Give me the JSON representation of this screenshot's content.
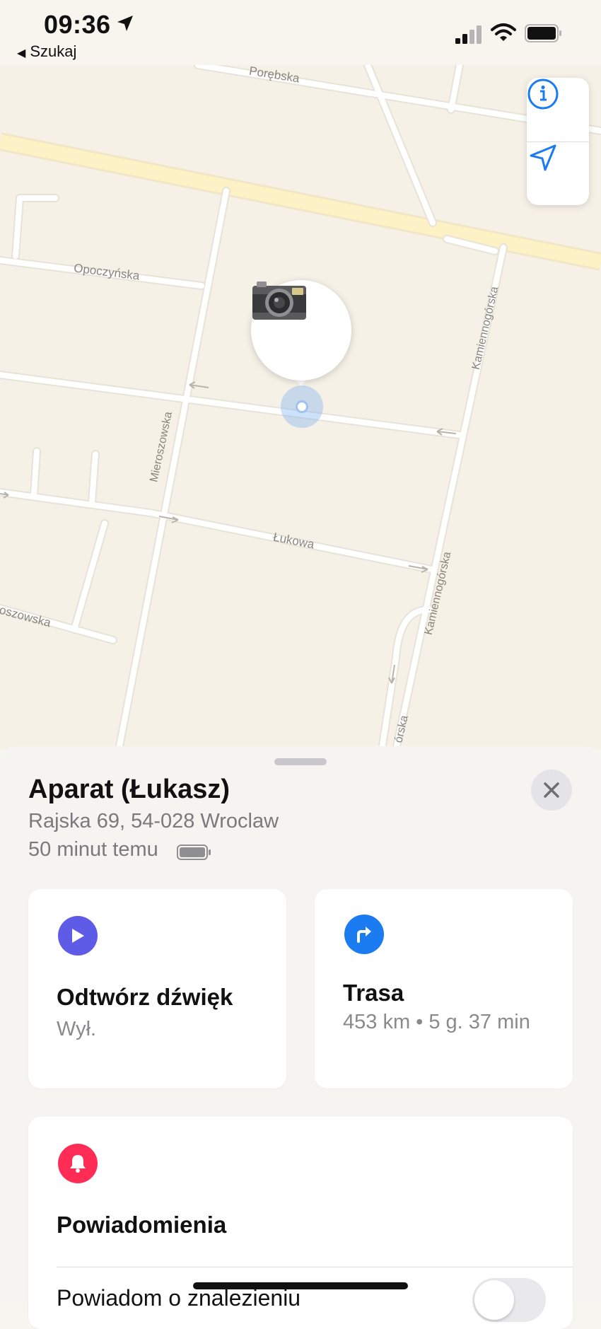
{
  "status_bar": {
    "time": "09:36",
    "back_label": "Szukaj"
  },
  "map": {
    "street_labels": {
      "porebska": "Porębska",
      "opoczynska": "Opoczyńska",
      "kamiennogorska_1": "Kamiennogórska",
      "kamiennogorska_2": "Kamiennogórska",
      "kamiennogorska_3": "órska",
      "mieroszowska": "Mieroszowska",
      "lukowa": "Łukowa",
      "oszowska": "oszowska"
    },
    "buttons": {
      "info_icon": "info-icon",
      "location_icon": "location-arrow-icon"
    },
    "pin_icon": "camera-icon",
    "colors": {
      "land": "#f6f1e7",
      "road": "#ffffff",
      "major_road": "#fdf2c6",
      "accent_blue": "#1a7cf0"
    }
  },
  "sheet": {
    "title": "Aparat (Łukasz)",
    "address": "Rajska 69, 54-028 Wroclaw",
    "last_seen": "50 minut temu",
    "sound_card": {
      "title": "Odtwórz dźwięk",
      "subtitle": "Wył.",
      "icon": "play-icon",
      "icon_color": "#5e5ce6"
    },
    "route_card": {
      "title": "Trasa",
      "subtitle": "453 km • 5 g. 37 min",
      "icon": "turn-right-icon",
      "icon_color": "#1a7cf0"
    },
    "notifications_card": {
      "title": "Powiadomienia",
      "row_label": "Powiadom o znalezieniu",
      "icon": "bell-icon",
      "icon_color": "#ff2d55",
      "toggle_on": false
    }
  }
}
